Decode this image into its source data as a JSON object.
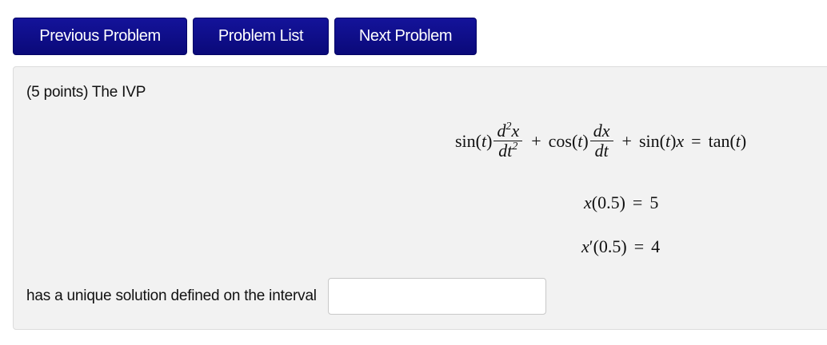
{
  "nav": {
    "previous_label": "Previous Problem",
    "list_label": "Problem List",
    "next_label": "Next Problem"
  },
  "problem": {
    "intro": "(5 points) The IVP",
    "equation": {
      "sin_t_1": "sin(",
      "t": "t",
      "close_paren": ")",
      "d2x_num_d": "d",
      "d2x_num_sup": "2",
      "d2x_num_x": "x",
      "d2x_den_dt": "dt",
      "d2x_den_sup": "2",
      "plus1": "+",
      "cos": "cos(",
      "dx_num": "dx",
      "dx_den": "dt",
      "plus2": "+",
      "sin_t_2": "sin(",
      "x": "x",
      "equals": "=",
      "tan": "tan(",
      "tan_close": ")"
    },
    "initial_condition_1": {
      "x": "x",
      "arg": "(0.5)",
      "equals": "=",
      "value": "5"
    },
    "initial_condition_2": {
      "x": "x",
      "prime": "′",
      "arg": "(0.5)",
      "equals": "=",
      "value": "4"
    },
    "answer_label": "has a unique solution defined on the interval",
    "answer_value": ""
  }
}
